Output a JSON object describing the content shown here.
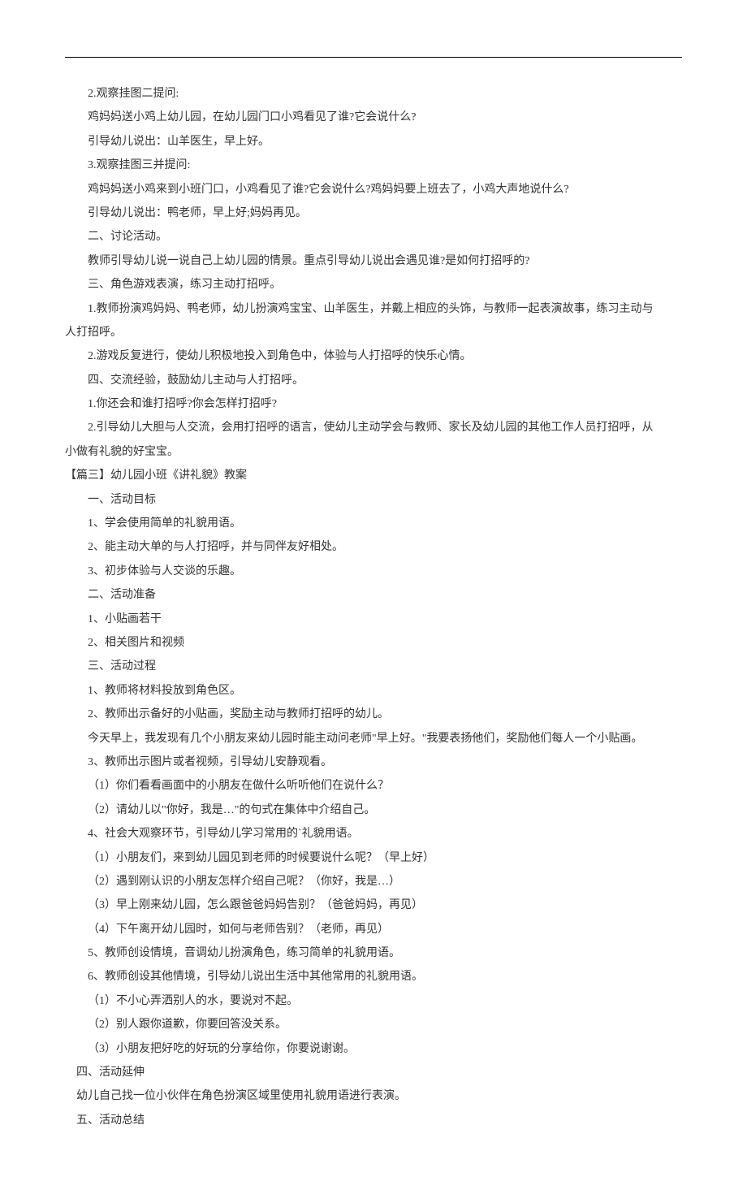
{
  "lines": [
    {
      "indent": "2em",
      "text": "2.观察挂图二提问:"
    },
    {
      "indent": "2em",
      "text": "鸡妈妈送小鸡上幼儿园，在幼儿园门口小鸡看见了谁?它会说什么?"
    },
    {
      "indent": "2em",
      "text": "引导幼儿说出：山羊医生，早上好。"
    },
    {
      "indent": "2em",
      "text": "3.观察挂图三并提问:"
    },
    {
      "indent": "2em",
      "text": "鸡妈妈送小鸡来到小班门口，小鸡看见了谁?它会说什么?鸡妈妈要上班去了，小鸡大声地说什么?"
    },
    {
      "indent": "2em",
      "text": "引导幼儿说出：鸭老师，早上好;妈妈再见。"
    },
    {
      "indent": "2em",
      "text": "二、讨论活动。"
    },
    {
      "indent": "2em",
      "text": "教师引导幼儿说一说自己上幼儿园的情景。重点引导幼儿说出会遇见谁?是如何打招呼的?"
    },
    {
      "indent": "2em",
      "text": "三、角色游戏表演，练习主动打招呼。"
    },
    {
      "indent": "2em",
      "text": "1.教师扮演鸡妈妈、鸭老师，幼儿扮演鸡宝宝、山羊医生，并戴上相应的头饰，与教师一起表演故事，练习主动与"
    },
    {
      "indent": "0",
      "text": "人打招呼。"
    },
    {
      "indent": "2em",
      "text": "2.游戏反复进行，使幼儿积极地投入到角色中，体验与人打招呼的快乐心情。"
    },
    {
      "indent": "2em",
      "text": "四、交流经验，鼓励幼儿主动与人打招呼。"
    },
    {
      "indent": "2em",
      "text": "1.你还会和谁打招呼?你会怎样打招呼?"
    },
    {
      "indent": "2em",
      "text": "2.引导幼儿大胆与人交流，会用打招呼的语言，使幼儿主动学会与教师、家长及幼儿园的其他工作人员打招呼，从"
    },
    {
      "indent": "0",
      "text": "小做有礼貌的好宝宝。"
    },
    {
      "indent": "0",
      "text": "【篇三】幼儿园小班《讲礼貌》教案"
    },
    {
      "indent": "2em",
      "text": "一、活动目标"
    },
    {
      "indent": "2em",
      "text": "1、学会使用简单的礼貌用语。"
    },
    {
      "indent": "2em",
      "text": "2、能主动大单的与人打招呼，并与同伴友好相处。"
    },
    {
      "indent": "2em",
      "text": "3、初步体验与人交谈的乐趣。"
    },
    {
      "indent": "2em",
      "text": "二、活动准备"
    },
    {
      "indent": "2em",
      "text": "1、小贴画若干"
    },
    {
      "indent": "2em",
      "text": "2、相关图片和视频"
    },
    {
      "indent": "2em",
      "text": "三、活动过程"
    },
    {
      "indent": "2em",
      "text": "1、教师将材料投放到角色区。"
    },
    {
      "indent": "2em",
      "text": "2、教师出示备好的小贴画，奖励主动与教师打招呼的幼儿。"
    },
    {
      "indent": "2em",
      "text": "今天早上，我发现有几个小朋友来幼儿园时能主动问老师\"早上好。\"我要表扬他们，奖励他们每人一个小贴画。"
    },
    {
      "indent": "2em",
      "text": "3、教师出示图片或者视频，引导幼儿安静观看。"
    },
    {
      "indent": "2em",
      "text": "（1）你们看看画面中的小朋友在做什么听听他们在说什么？"
    },
    {
      "indent": "2em",
      "text": "（2）请幼儿以\"你好，我是…\"的句式在集体中介绍自己。"
    },
    {
      "indent": "2em",
      "text": "4、社会大观察环节，引导幼儿学习常用的`礼貌用语。"
    },
    {
      "indent": "2em",
      "text": "（1）小朋友们，来到幼儿园见到老师的时候要说什么呢？（早上好）"
    },
    {
      "indent": "2em",
      "text": "（2）遇到刚认识的小朋友怎样介绍自己呢？（你好，我是…）"
    },
    {
      "indent": "2em",
      "text": "（3）早上刚来幼儿园，怎么跟爸爸妈妈告别？（爸爸妈妈，再见）"
    },
    {
      "indent": "2em",
      "text": "（4）下午离开幼儿园时，如何与老师告别？（老师，再见）"
    },
    {
      "indent": "2em",
      "text": "5、教师创设情境，音调幼儿扮演角色，练习简单的礼貌用语。"
    },
    {
      "indent": "2em",
      "text": "6、教师创设其他情境，引导幼儿说出生活中其他常用的礼貌用语。"
    },
    {
      "indent": "2em",
      "text": "（1）不小心弄洒别人的水，要说对不起。"
    },
    {
      "indent": "2em",
      "text": "（2）别人跟你道歉，你要回答没关系。"
    },
    {
      "indent": "2em",
      "text": "（3）小朋友把好吃的好玩的分享给你，你要说谢谢。"
    },
    {
      "indent": "1em",
      "text": "四、活动延伸"
    },
    {
      "indent": "1em",
      "text": "幼儿自己找一位小伙伴在角色扮演区域里使用礼貌用语进行表演。"
    },
    {
      "indent": "1em",
      "text": "五、活动总结"
    }
  ]
}
